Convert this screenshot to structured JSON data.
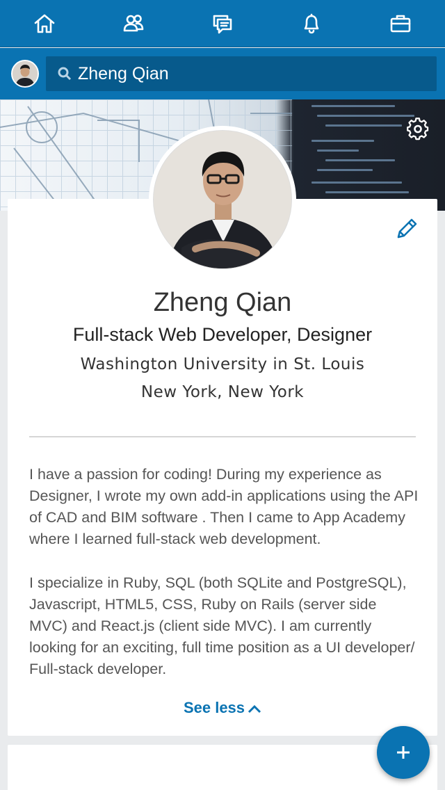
{
  "nav": {
    "items": [
      {
        "icon": "home-icon"
      },
      {
        "icon": "people-icon"
      },
      {
        "icon": "messages-icon"
      },
      {
        "icon": "bell-icon"
      },
      {
        "icon": "briefcase-icon"
      }
    ]
  },
  "search": {
    "value": "Zheng Qian"
  },
  "profile": {
    "name": "Zheng Qian",
    "headline": "Full-stack Web Developer, Designer",
    "school": "Washington University in St. Louis",
    "location": "New York, New York",
    "summary_p1": "I have a passion for coding! During my experience as Designer, I wrote my own add-in applications using the API of CAD and BIM software . Then I came to App Academy where I learned full-stack web development.",
    "summary_p2": "I specialize in Ruby, SQL (both SQLite and PostgreSQL), Javascript, HTML5, CSS, Ruby on Rails (server side MVC) and React.js (client side MVC). I am currently looking for an exciting, full time position as a UI developer/ Full-stack developer.",
    "see_less": "See less"
  },
  "colors": {
    "brand": "#0a73b2",
    "search_bg": "#075a8c"
  }
}
